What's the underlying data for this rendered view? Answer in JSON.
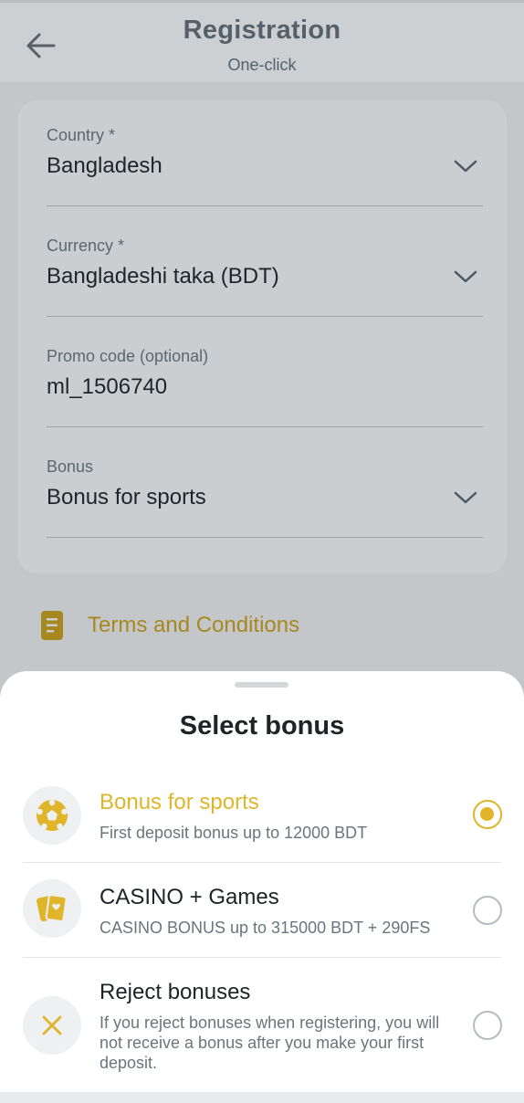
{
  "header": {
    "title": "Registration",
    "subtitle": "One-click",
    "back_icon": "arrow-left-icon"
  },
  "form": {
    "fields": [
      {
        "label": "Country *",
        "value": "Bangladesh",
        "dropdown": true
      },
      {
        "label": "Currency *",
        "value": "Bangladeshi taka (BDT)",
        "dropdown": true
      },
      {
        "label": "Promo code (optional)",
        "value": "ml_1506740",
        "dropdown": false
      },
      {
        "label": "Bonus",
        "value": "Bonus for sports",
        "dropdown": true
      }
    ]
  },
  "terms": {
    "label": "Terms and Conditions",
    "icon": "document-icon"
  },
  "sheet": {
    "title": "Select bonus",
    "options": [
      {
        "title": "Bonus for sports",
        "desc": "First deposit bonus up to 12000 BDT",
        "icon": "soccer-ball-icon",
        "selected": true
      },
      {
        "title": "CASINO + Games",
        "desc": "CASINO BONUS up to 315000 BDT + 290FS",
        "icon": "playing-cards-icon",
        "selected": false
      },
      {
        "title": "Reject bonuses",
        "desc": "If you reject bonuses when registering, you will not receive a bonus after you make your first deposit.",
        "icon": "close-x-icon",
        "selected": false
      }
    ]
  },
  "colors": {
    "accent": "#e0b52a",
    "overlay_bg": "#c4c7c9",
    "sheet_bg": "#ffffff"
  }
}
